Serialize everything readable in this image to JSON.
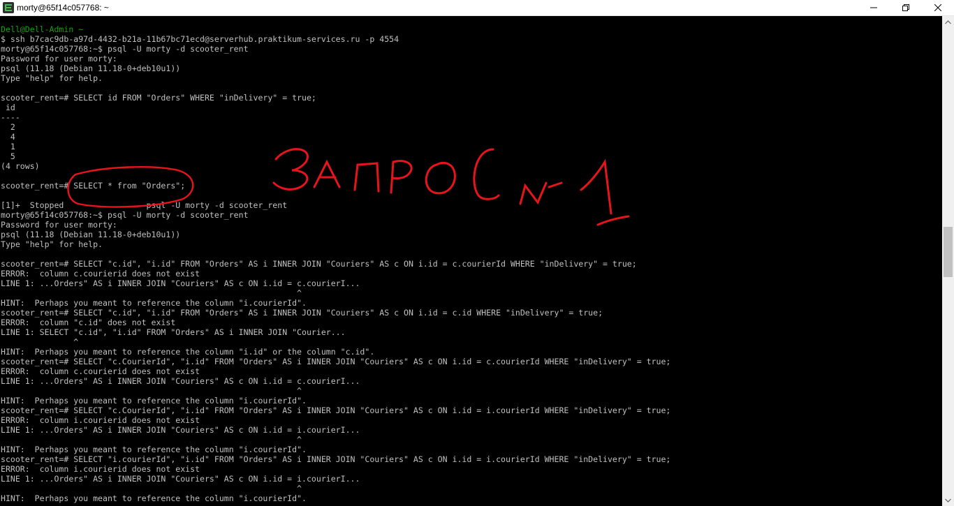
{
  "window": {
    "title": "morty@65f14c057768: ~",
    "icon": "terminal-app-icon",
    "controls": [
      "minimize-icon",
      "maximize-icon",
      "close-icon"
    ]
  },
  "terminal": {
    "lines": [
      {
        "text": "Dell@Dell-Admin ~",
        "kind": "prompt-host"
      },
      {
        "text": "$ ssh b7cac9db-a97d-4432-b21a-11b67bc71ecd@serverhub.praktikum-services.ru -p 4554"
      },
      {
        "text": "morty@65f14c057768:~$ psql -U morty -d scooter_rent"
      },
      {
        "text": "Password for user morty:"
      },
      {
        "text": "psql (11.18 (Debian 11.18-0+deb10u1))"
      },
      {
        "text": "Type \"help\" for help."
      },
      {
        "text": ""
      },
      {
        "text": "scooter_rent=# SELECT id FROM \"Orders\" WHERE \"inDelivery\" = true;"
      },
      {
        "text": " id"
      },
      {
        "text": "----"
      },
      {
        "text": "  2"
      },
      {
        "text": "  4"
      },
      {
        "text": "  1"
      },
      {
        "text": "  5"
      },
      {
        "text": "(4 rows)"
      },
      {
        "text": ""
      },
      {
        "text": "scooter_rent=# SELECT * from \"Orders\";"
      },
      {
        "text": ""
      },
      {
        "text": "[1]+  Stopped                 psql -U morty -d scooter_rent"
      },
      {
        "text": "morty@65f14c057768:~$ psql -U morty -d scooter_rent"
      },
      {
        "text": "Password for user morty:"
      },
      {
        "text": "psql (11.18 (Debian 11.18-0+deb10u1))"
      },
      {
        "text": "Type \"help\" for help."
      },
      {
        "text": ""
      },
      {
        "text": "scooter_rent=# SELECT \"c.id\", \"i.id\" FROM \"Orders\" AS i INNER JOIN \"Couriers\" AS c ON i.id = c.courierId WHERE \"inDelivery\" = true;"
      },
      {
        "text": "ERROR:  column c.courierid does not exist"
      },
      {
        "text": "LINE 1: ...Orders\" AS i INNER JOIN \"Couriers\" AS c ON i.id = c.courierI..."
      },
      {
        "text": "                                                             ^"
      },
      {
        "text": "HINT:  Perhaps you meant to reference the column \"i.courierId\"."
      },
      {
        "text": "scooter_rent=# SELECT \"c.id\", \"i.id\" FROM \"Orders\" AS i INNER JOIN \"Couriers\" AS c ON i.id = c.id WHERE \"inDelivery\" = true;"
      },
      {
        "text": "ERROR:  column \"c.id\" does not exist"
      },
      {
        "text": "LINE 1: SELECT \"c.id\", \"i.id\" FROM \"Orders\" AS i INNER JOIN \"Courier..."
      },
      {
        "text": "               ^"
      },
      {
        "text": "HINT:  Perhaps you meant to reference the column \"i.id\" or the column \"c.id\"."
      },
      {
        "text": "scooter_rent=# SELECT \"c.CourierId\", \"i.id\" FROM \"Orders\" AS i INNER JOIN \"Couriers\" AS c ON i.id = c.courierId WHERE \"inDelivery\" = true;"
      },
      {
        "text": "ERROR:  column c.courierid does not exist"
      },
      {
        "text": "LINE 1: ...Orders\" AS i INNER JOIN \"Couriers\" AS c ON i.id = c.courierI..."
      },
      {
        "text": "                                                             ^"
      },
      {
        "text": "HINT:  Perhaps you meant to reference the column \"i.courierId\"."
      },
      {
        "text": "scooter_rent=# SELECT \"c.CourierId\", \"i.id\" FROM \"Orders\" AS i INNER JOIN \"Couriers\" AS c ON i.id = i.courierId WHERE \"inDelivery\" = true;"
      },
      {
        "text": "ERROR:  column i.courierid does not exist"
      },
      {
        "text": "LINE 1: ...Orders\" AS i INNER JOIN \"Couriers\" AS c ON i.id = i.courierI..."
      },
      {
        "text": "                                                             ^"
      },
      {
        "text": "HINT:  Perhaps you meant to reference the column \"i.courierId\"."
      },
      {
        "text": "scooter_rent=# SELECT \"i.courierId\", \"i.id\" FROM \"Orders\" AS i INNER JOIN \"Couriers\" AS c ON i.id = i.courierId WHERE \"inDelivery\" = true;"
      },
      {
        "text": "ERROR:  column i.courierid does not exist"
      },
      {
        "text": "LINE 1: ...Orders\" AS i INNER JOIN \"Couriers\" AS c ON i.id = i.courierI..."
      },
      {
        "text": "                                                             ^"
      },
      {
        "text": "HINT:  Perhaps you meant to reference the column \"i.courierId\"."
      }
    ]
  },
  "annotation": {
    "handwritten_text": "запрос №1",
    "color": "#e8141c"
  },
  "colors": {
    "terminal_bg": "#000000",
    "terminal_fg": "#c0c0c0",
    "prompt_host": "#13a10e",
    "titlebar_bg": "#ffffff",
    "scrollbar_bg": "#f0f0f0",
    "scrollbar_thumb": "#c1c1c1"
  }
}
